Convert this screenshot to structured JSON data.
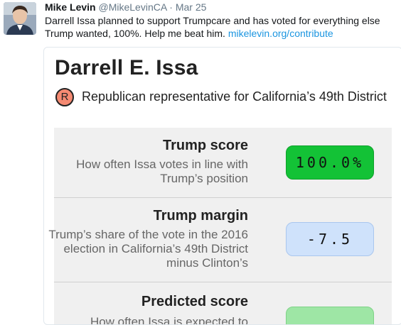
{
  "tweet": {
    "author_name": "Mike Levin",
    "author_handle": "@MikeLevinCA",
    "separator": "·",
    "time": "Mar 25",
    "text": "Darrell Issa planned to support Trumpcare and has voted for everything else Trump wanted, 100%.  Help me beat him.",
    "link": "mikelevin.org/contribute"
  },
  "card": {
    "name": "Darrell E. Issa",
    "party_letter": "R",
    "party_color": "#f58a72",
    "district": "Republican representative for California’s 49th District",
    "stats": [
      {
        "label": "Trump score",
        "description": "How often Issa votes in line with Trump’s position",
        "value": "100.0%",
        "color": "#13c236"
      },
      {
        "label": "Trump margin",
        "description": "Trump’s share of the vote in the 2016 election in California’s 49th District minus Clinton’s",
        "value": "-7.5",
        "color": "#cfe2fb"
      },
      {
        "label": "Predicted score",
        "description": "How often Issa is expected to",
        "value": "",
        "color": "#9ee6a5"
      }
    ]
  }
}
